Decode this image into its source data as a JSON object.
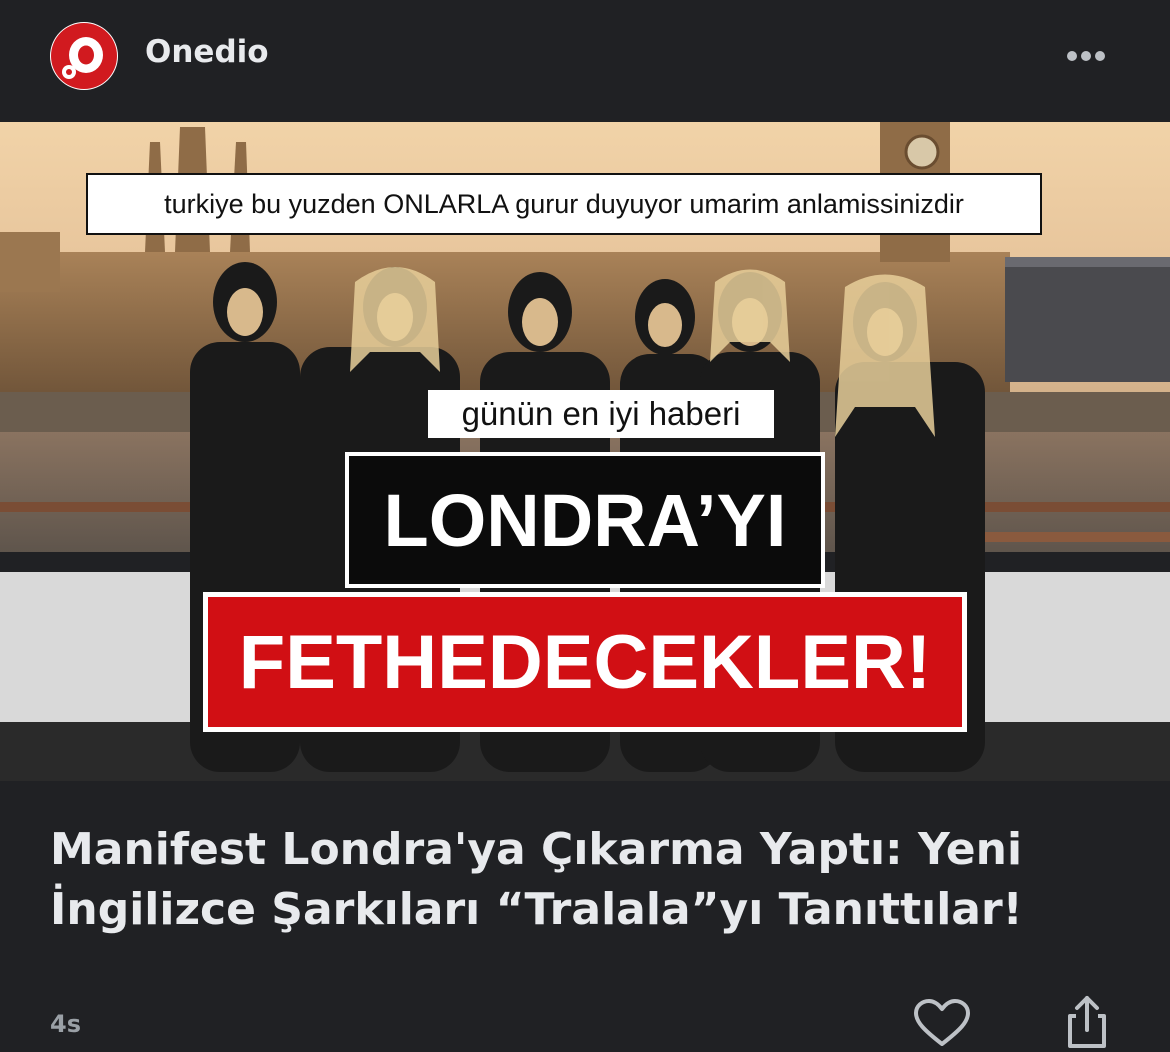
{
  "header": {
    "source_name": "Onedio"
  },
  "thumbnail": {
    "quote_text": "turkiye bu yuzden ONLARLA gurur duyuyor umarim anlamissinizdir",
    "sub_label": "günün en iyi haberi",
    "headline_line1": "LONDRA’YI",
    "headline_line2": "FETHEDECEKLER!"
  },
  "article": {
    "title": "Manifest Londra'ya Çıkarma Yaptı: Yeni İngilizce Şarkıları “Tralala”yı Tanıttılar!",
    "timestamp": "4s"
  },
  "colors": {
    "background": "#202124",
    "brand_red": "#d10f14",
    "text": "#e8eaed",
    "muted": "#9aa0a6"
  },
  "icons": {
    "logo": "onedio-logo",
    "more": "more-horizontal-icon",
    "like": "heart-icon",
    "share": "share-icon"
  }
}
